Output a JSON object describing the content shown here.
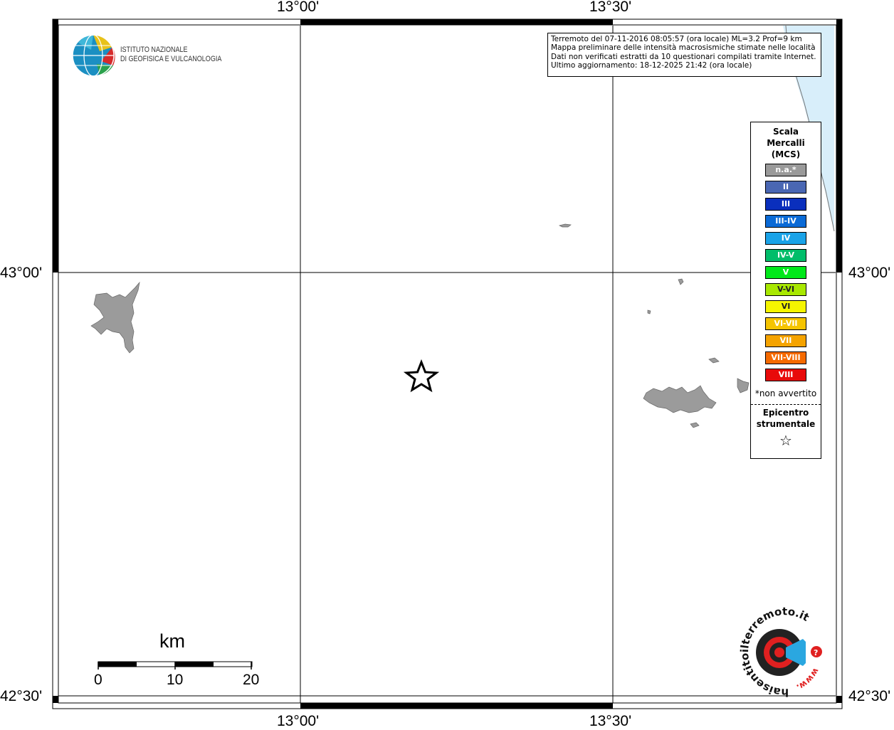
{
  "map": {
    "lon_labels": [
      "13°00'",
      "13°30'"
    ],
    "lat_labels": [
      "43°00'",
      "42°30'"
    ]
  },
  "logo": {
    "line1": "ISTITUTO NAZIONALE",
    "line2": "DI GEOFISICA E VULCANOLOGIA"
  },
  "info": {
    "line1": "Terremoto del 07-11-2016 08:05:57 (ora locale) ML=3.2 Prof=9 km",
    "line2": "Mappa preliminare delle intensità macrosismiche stimate nelle località",
    "line3": "Dati non verificati estratti da 10 questionari compilati tramite Internet.",
    "line4": "Ultimo aggiornamento: 18-12-2025 21:42 (ora locale)"
  },
  "legend": {
    "title_l1": "Scala",
    "title_l2": "Mercalli",
    "title_l3": "(MCS)",
    "items": [
      {
        "label": "n.a.*",
        "color": "#9a9a9a"
      },
      {
        "label": "II",
        "color": "#4a67b3"
      },
      {
        "label": "III",
        "color": "#0a2fbd"
      },
      {
        "label": "III-IV",
        "color": "#0a6ad6"
      },
      {
        "label": "IV",
        "color": "#1aa3e8"
      },
      {
        "label": "IV-V",
        "color": "#00bd6a"
      },
      {
        "label": "V",
        "color": "#00e81a"
      },
      {
        "label": "V-VI",
        "color": "#a8e800"
      },
      {
        "label": "VI",
        "color": "#f5f500"
      },
      {
        "label": "VI-VII",
        "color": "#f5c400"
      },
      {
        "label": "VII",
        "color": "#f5a300"
      },
      {
        "label": "VII-VIII",
        "color": "#f56a00"
      },
      {
        "label": "VIII",
        "color": "#e80a0a"
      }
    ],
    "note": "*non avvertito",
    "epi_l1": "Epicentro",
    "epi_l2": "strumentale",
    "epi_symbol": "☆"
  },
  "scale": {
    "unit": "km",
    "ticks": [
      "0",
      "10",
      "20"
    ]
  },
  "brand": {
    "text": "haisentitoilterremoto.it",
    "url": "www."
  },
  "colors": {
    "sea": "#d8eefa",
    "land_feature": "#9b9b9b"
  }
}
